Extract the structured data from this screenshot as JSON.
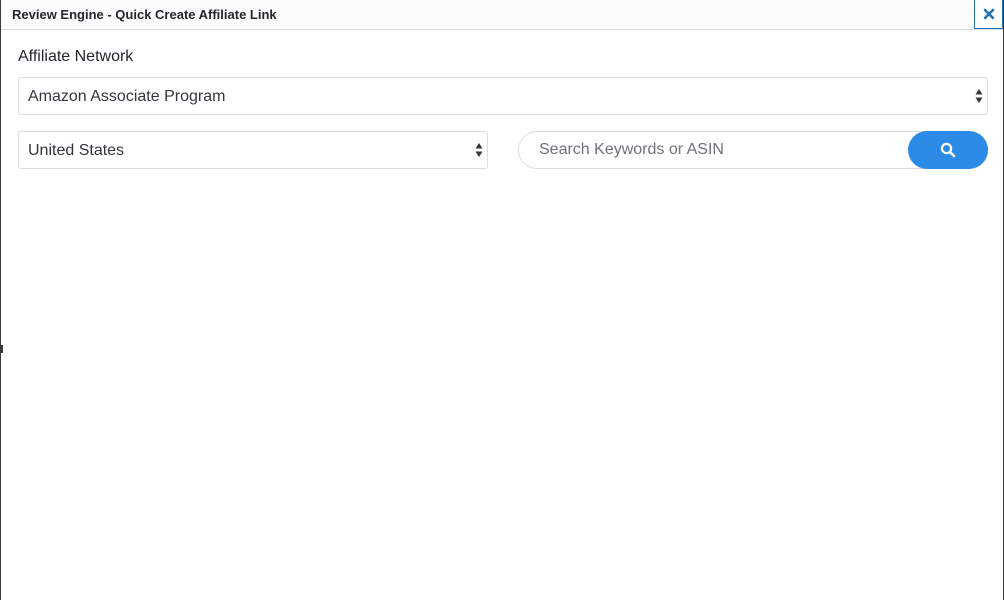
{
  "dialog": {
    "title": "Review Engine - Quick Create Affiliate Link",
    "close_icon": "close-icon"
  },
  "form": {
    "network_label": "Affiliate Network",
    "network_selected": "Amazon Associate Program",
    "country_selected": "United States",
    "search_placeholder": "Search Keywords or ASIN",
    "search_value": "",
    "search_icon": "search-icon"
  },
  "colors": {
    "accent": "#2b8be6",
    "close_icon": "#2271b1",
    "border": "#dcdcdc",
    "text": "#23282d"
  }
}
